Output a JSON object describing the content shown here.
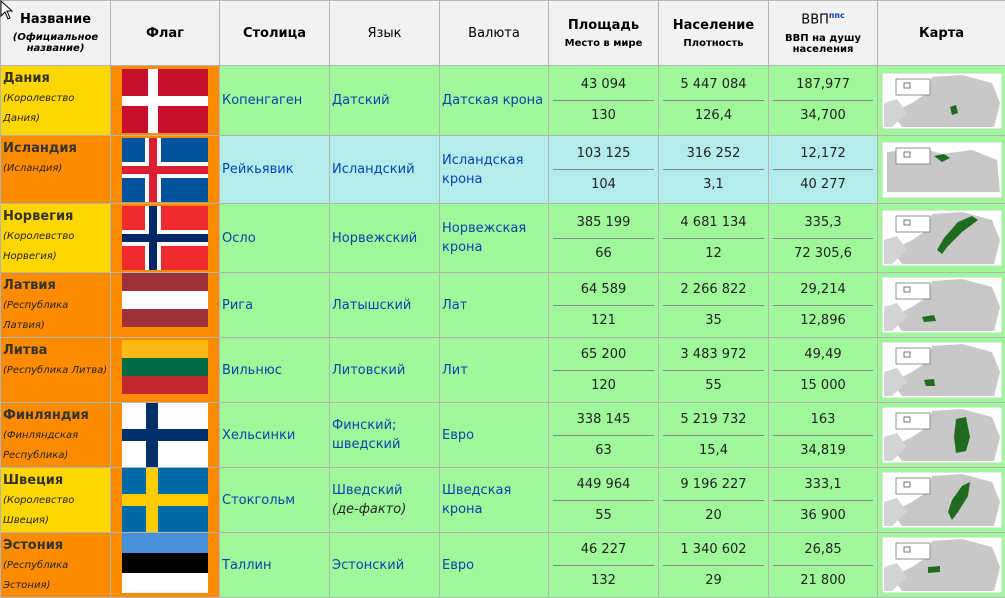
{
  "header": {
    "name": "Название",
    "name_sub": "(Официальное название)",
    "flag": "Флаг",
    "capital": "Столица",
    "language": "Язык",
    "currency": "Валюта",
    "area": "Площадь",
    "area_sub": "Место в мире",
    "population": "Население",
    "population_sub": "Плотность",
    "gdp": "ВВП",
    "gdp_sup": "ппс",
    "gdp_sub": "ВВП на душу населения",
    "map": "Карта"
  },
  "rows": [
    {
      "name": "Дания",
      "official": "(Королевство Дания)",
      "capital": "Копенгаген",
      "language": "Датский",
      "language2": "",
      "currency": "Датская крона",
      "area": "43 094",
      "area_rank": "130",
      "population": "5 447 084",
      "density": "126,4",
      "gdp": "187,977",
      "gdp_pc": "34,700",
      "flag": "denmark-flag",
      "map": "map-denmark"
    },
    {
      "name": "Исландия",
      "official": "(Исландия)",
      "capital": "Рейкьявик",
      "language": "Исландский",
      "language2": "",
      "currency": "Исландская крона",
      "area": "103 125",
      "area_rank": "104",
      "population": "316 252",
      "density": "3,1",
      "gdp": "12,172",
      "gdp_pc": "40 277",
      "flag": "iceland-flag",
      "map": "map-iceland"
    },
    {
      "name": "Норвегия",
      "official": "(Королевство Норвегия)",
      "capital": "Осло",
      "language": "Норвежский",
      "language2": "",
      "currency": "Норвежская крона",
      "area": "385 199",
      "area_rank": "66",
      "population": "4 681 134",
      "density": "12",
      "gdp": "335,3",
      "gdp_pc": "72 305,6",
      "flag": "norway-flag",
      "map": "map-norway"
    },
    {
      "name": "Латвия",
      "official": "(Республика Латвия)",
      "capital": "Рига",
      "language": "Латышский",
      "language2": "",
      "currency": "Лат",
      "area": "64 589",
      "area_rank": "121",
      "population": "2 266 822",
      "density": "35",
      "gdp": "29,214",
      "gdp_pc": "12,896",
      "flag": "latvia-flag",
      "map": "map-latvia"
    },
    {
      "name": "Литва",
      "official": "(Республика Литва)",
      "capital": "Вильнюс",
      "language": "Литовский",
      "language2": "",
      "currency": "Лит",
      "area": "65 200",
      "area_rank": "120",
      "population": "3 483 972",
      "density": "55",
      "gdp": "49,49",
      "gdp_pc": "15 000",
      "flag": "lithuania-flag",
      "map": "map-lithuania"
    },
    {
      "name": "Финляндия",
      "official": "(Финляндская Республика)",
      "capital": "Хельсинки",
      "language": "Финский;",
      "language2": "шведский",
      "currency": "Евро",
      "area": "338 145",
      "area_rank": "63",
      "population": "5 219 732",
      "density": "15,4",
      "gdp": "163",
      "gdp_pc": "34,819",
      "flag": "finland-flag",
      "map": "map-finland"
    },
    {
      "name": "Швеция",
      "official": "(Королевство Швеция)",
      "capital": "Стокгольм",
      "language": "Шведский",
      "language2": "(де-факто)",
      "currency": "Шведская крона",
      "area": "449 964",
      "area_rank": "55",
      "population": "9 196 227",
      "density": "20",
      "gdp": "333,1",
      "gdp_pc": "36 900",
      "flag": "sweden-flag",
      "map": "map-sweden"
    },
    {
      "name": "Эстония",
      "official": "(Республика Эстония)",
      "capital": "Таллин",
      "language": "Эстонский",
      "language2": "",
      "currency": "Евро",
      "area": "46 227",
      "area_rank": "132",
      "population": "1 340 602",
      "density": "29",
      "gdp": "26,85",
      "gdp_pc": "21 800",
      "flag": "estonia-flag",
      "map": "map-estonia"
    }
  ],
  "colors": {
    "header_bg": "#f2f2f2",
    "yellow": "#ffd700",
    "orange": "#ff8c00",
    "green": "#9ff899",
    "cyan": "#b4ecec",
    "link": "#0645ad"
  }
}
